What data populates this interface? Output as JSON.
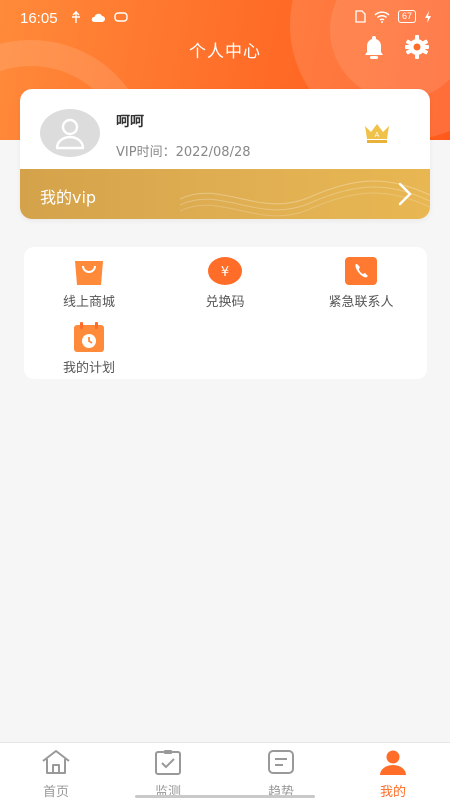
{
  "status": {
    "time": "16:05",
    "battery": "67"
  },
  "header": {
    "title": "个人中心"
  },
  "profile": {
    "name": "呵呵",
    "vip_time": "VIP时间：2022/08/28",
    "crown_letter": "A",
    "vip_label": "我的vip"
  },
  "services": [
    {
      "label": "线上商城",
      "icon": "shopping-bag-icon"
    },
    {
      "label": "兑换码",
      "icon": "yuan-coin-icon",
      "glyph": "¥"
    },
    {
      "label": "紧急联系人",
      "icon": "phone-book-icon"
    },
    {
      "label": "我的计划",
      "icon": "calendar-icon"
    }
  ],
  "tabbar": {
    "items": [
      {
        "label": "首页",
        "icon": "home-icon",
        "active": false
      },
      {
        "label": "监测",
        "icon": "clipboard-check-icon",
        "active": false
      },
      {
        "label": "趋势",
        "icon": "chart-note-icon",
        "active": false
      },
      {
        "label": "我的",
        "icon": "user-icon",
        "active": true
      }
    ]
  },
  "colors": {
    "accent": "#ff6d28",
    "vip_gold": "#dfae52",
    "icon_orange": "#ff8a3a"
  }
}
